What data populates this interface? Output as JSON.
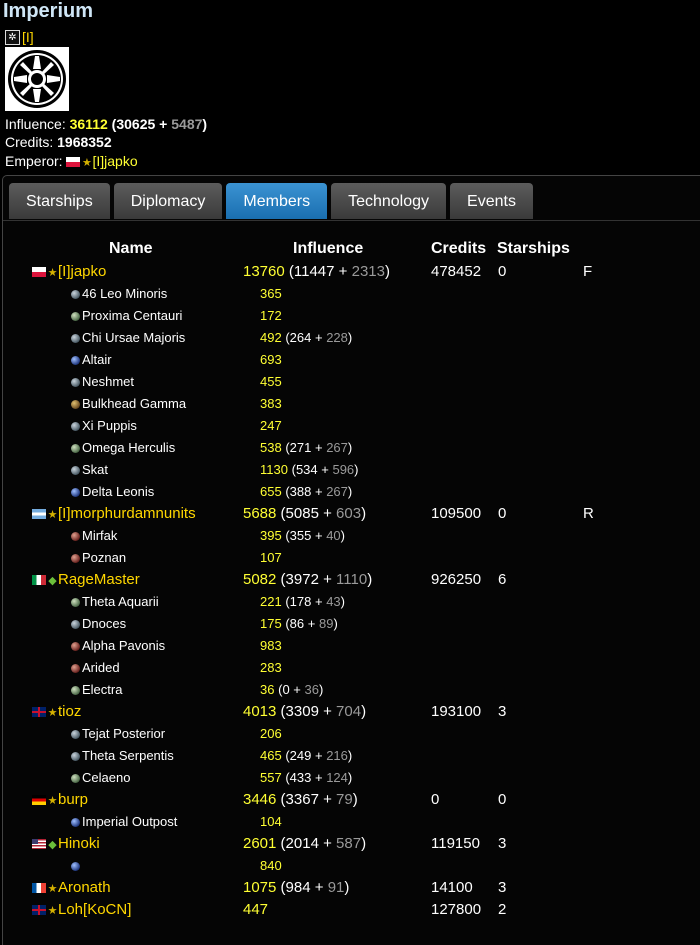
{
  "title": "Imperium",
  "tag": "[I]",
  "influence": {
    "label": "Influence:",
    "total": "36112",
    "open": "(",
    "a": "30625",
    "plus": "+",
    "b": "5487",
    "close": ")"
  },
  "credits": {
    "label": "Credits:",
    "value": "1968352"
  },
  "emperor": {
    "label": "Emperor:",
    "name": "[I]japko"
  },
  "tabs": [
    "Starships",
    "Diplomacy",
    "Members",
    "Technology",
    "Events"
  ],
  "active_tab": "Members",
  "headers": {
    "name": "Name",
    "influence": "Influence",
    "credits": "Credits",
    "starships": "Starships"
  },
  "members": [
    {
      "name": "[I]japko",
      "flag": "pl",
      "rank": "star",
      "inf": "13760",
      "a": "11447",
      "b": "2313",
      "credits": "478452",
      "ships": "0",
      "x": "F",
      "planets": [
        {
          "n": "46 Leo Minoris",
          "v": "365"
        },
        {
          "n": "Proxima Centauri",
          "v": "172"
        },
        {
          "n": "Chi Ursae Majoris",
          "v": "492",
          "a": "264",
          "b": "228"
        },
        {
          "n": "Altair",
          "v": "693"
        },
        {
          "n": "Neshmet",
          "v": "455"
        },
        {
          "n": "Bulkhead Gamma",
          "v": "383"
        },
        {
          "n": "Xi Puppis",
          "v": "247"
        },
        {
          "n": "Omega Herculis",
          "v": "538",
          "a": "271",
          "b": "267"
        },
        {
          "n": "Skat",
          "v": "1130",
          "a": "534",
          "b": "596"
        },
        {
          "n": "Delta Leonis",
          "v": "655",
          "a": "388",
          "b": "267"
        }
      ]
    },
    {
      "name": "[I]morphurdamnunits",
      "flag": "ar",
      "rank": "star",
      "inf": "5688",
      "a": "5085",
      "b": "603",
      "credits": "109500",
      "ships": "0",
      "x": "R",
      "planets": [
        {
          "n": "Mirfak",
          "v": "395",
          "a": "355",
          "b": "40"
        },
        {
          "n": "Poznan",
          "v": "107"
        }
      ]
    },
    {
      "name": "RageMaster",
      "flag": "it",
      "rank": "green",
      "inf": "5082",
      "a": "3972",
      "b": "1110",
      "credits": "926250",
      "ships": "6",
      "x": "",
      "planets": [
        {
          "n": "Theta Aquarii",
          "v": "221",
          "a": "178",
          "b": "43"
        },
        {
          "n": "Dnoces",
          "v": "175",
          "a": "86",
          "b": "89"
        },
        {
          "n": "Alpha Pavonis",
          "v": "983"
        },
        {
          "n": "Arided",
          "v": "283"
        },
        {
          "n": "Electra",
          "v": "36",
          "a": "0",
          "b": "36"
        }
      ]
    },
    {
      "name": "tioz",
      "flag": "uk",
      "rank": "star",
      "inf": "4013",
      "a": "3309",
      "b": "704",
      "credits": "193100",
      "ships": "3",
      "x": "",
      "planets": [
        {
          "n": "Tejat Posterior",
          "v": "206"
        },
        {
          "n": "Theta Serpentis",
          "v": "465",
          "a": "249",
          "b": "216"
        },
        {
          "n": "Celaeno",
          "v": "557",
          "a": "433",
          "b": "124"
        }
      ]
    },
    {
      "name": "burp",
      "flag": "de",
      "rank": "star",
      "inf": "3446",
      "a": "3367",
      "b": "79",
      "credits": "0",
      "ships": "0",
      "x": "",
      "planets": [
        {
          "n": "Imperial Outpost",
          "v": "104"
        }
      ]
    },
    {
      "name": "Hinoki",
      "flag": "us",
      "rank": "green",
      "inf": "2601",
      "a": "2014",
      "b": "587",
      "credits": "119150",
      "ships": "3",
      "x": "",
      "planets": [
        {
          "n": "",
          "v": "840"
        }
      ]
    },
    {
      "name": "Aronath",
      "flag": "fr",
      "rank": "star",
      "inf": "1075",
      "a": "984",
      "b": "91",
      "credits": "14100",
      "ships": "3",
      "x": "",
      "planets": []
    },
    {
      "name": "Loh[KoCN]",
      "flag": "uk",
      "rank": "star",
      "inf": "447",
      "credits": "127800",
      "ships": "2",
      "x": "",
      "planets": []
    }
  ]
}
